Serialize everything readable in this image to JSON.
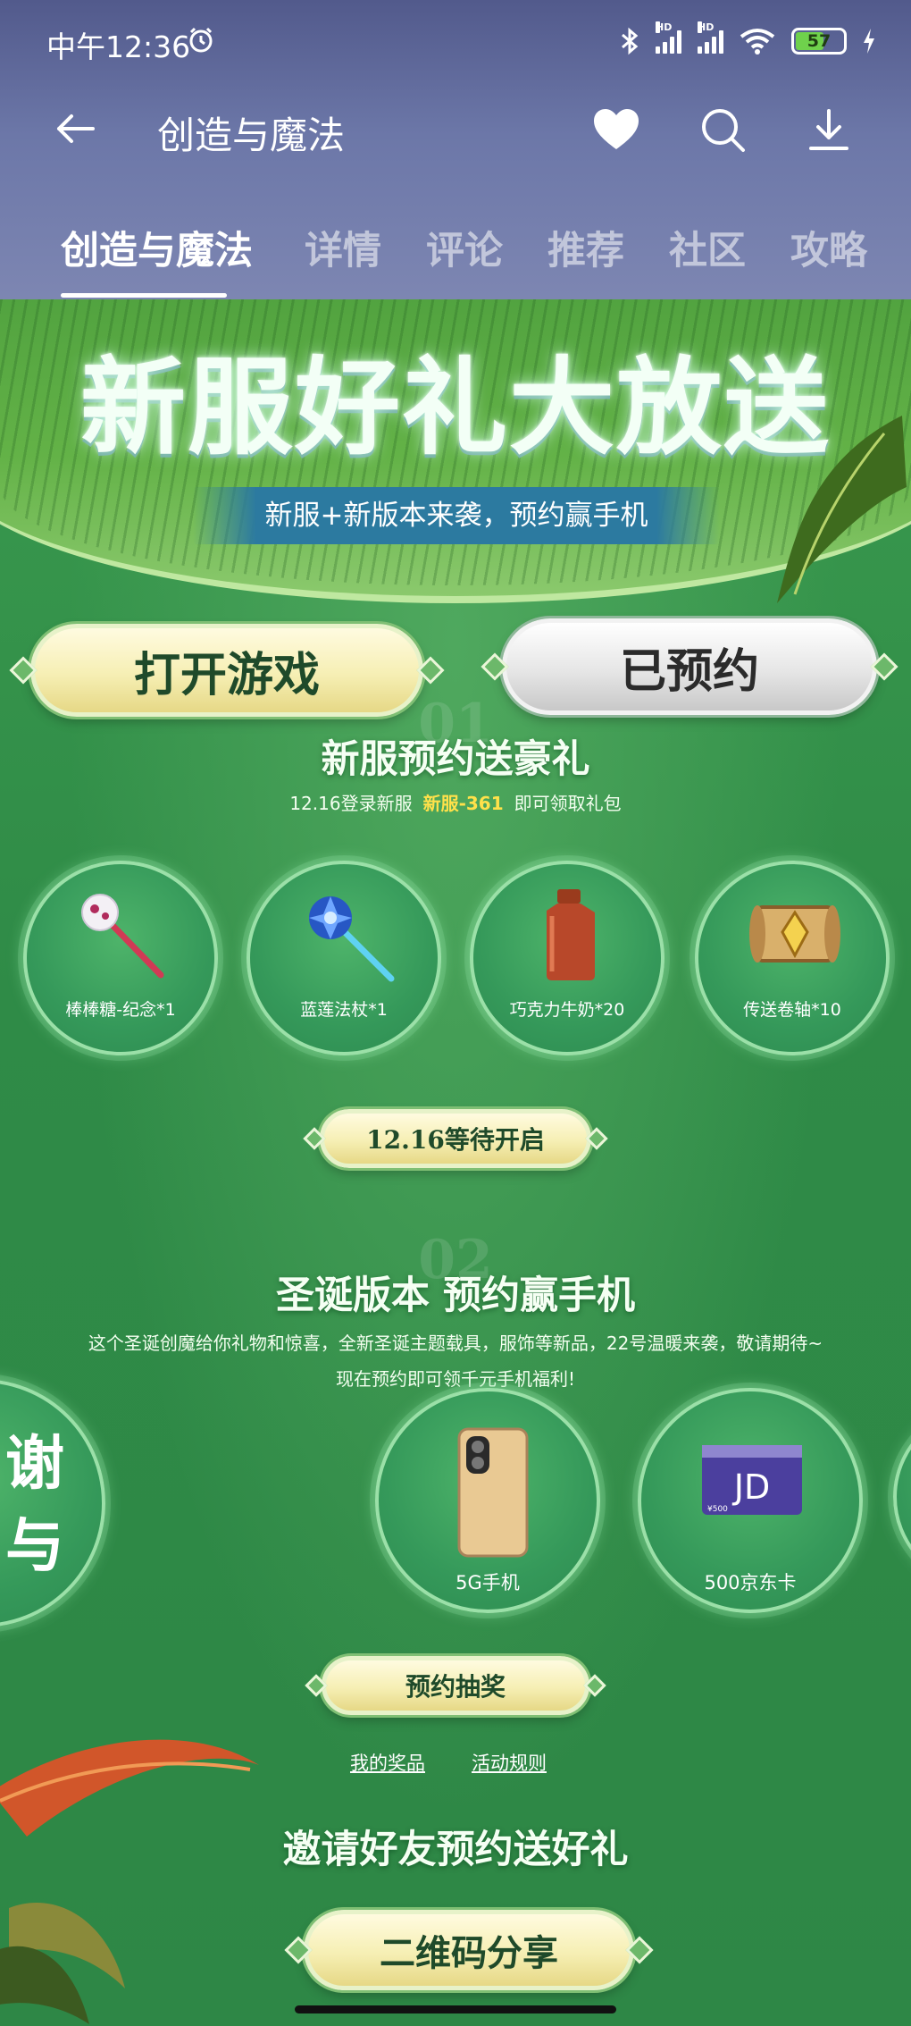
{
  "status_bar": {
    "time": "中午12:36",
    "signal1_label": "HD",
    "signal2_label": "HD",
    "battery": "57"
  },
  "app_bar": {
    "title": "创造与魔法"
  },
  "tabs": [
    {
      "label": "创造与魔法"
    },
    {
      "label": "详情"
    },
    {
      "label": "评论"
    },
    {
      "label": "推荐"
    },
    {
      "label": "社区"
    },
    {
      "label": "攻略"
    }
  ],
  "banner": {
    "title": "新服好礼大放送",
    "subtitle": "新服+新版本来袭，预约赢手机"
  },
  "buttons": {
    "open_game": "打开游戏",
    "reserved": "已预约"
  },
  "section1": {
    "number": "01",
    "title": "新服预约送豪礼",
    "desc_prefix": "12.16登录新服",
    "desc_highlight": "新服-361",
    "desc_suffix": "即可领取礼包",
    "rewards": [
      {
        "label": "棒棒糖-纪念*1",
        "icon": "lollipop-icon"
      },
      {
        "label": "蓝莲法杖*1",
        "icon": "blue-lotus-staff-icon"
      },
      {
        "label": "巧克力牛奶*20",
        "icon": "chocolate-milk-icon"
      },
      {
        "label": "传送卷轴*10",
        "icon": "teleport-scroll-icon"
      }
    ],
    "wait_button": "12.16等待开启"
  },
  "section2": {
    "number": "02",
    "title": "圣诞版本 预约赢手机",
    "desc_line1": "这个圣诞创魔给你礼物和惊喜，全新圣诞主题载具，服饰等新品，22号温暖来袭，敬请期待~",
    "desc_line2": "现在预约即可领千元手机福利!",
    "partial_prize_text": "谢\n与",
    "prizes": [
      {
        "label": "5G手机",
        "icon": "smartphone-icon"
      },
      {
        "label": "500京东卡",
        "icon": "jd-card-icon",
        "card_text": "JD",
        "card_value": "¥500"
      }
    ],
    "lottery_button": "预约抽奖",
    "my_prizes_link": "我的奖品",
    "rules_link": "活动规则"
  },
  "section3": {
    "title": "邀请好友预约送好礼",
    "share_button": "二维码分享"
  },
  "colors": {
    "header_bg": "#5f6a9c",
    "content_green": "#2f8b47",
    "highlight_yellow": "#ffe14a"
  }
}
